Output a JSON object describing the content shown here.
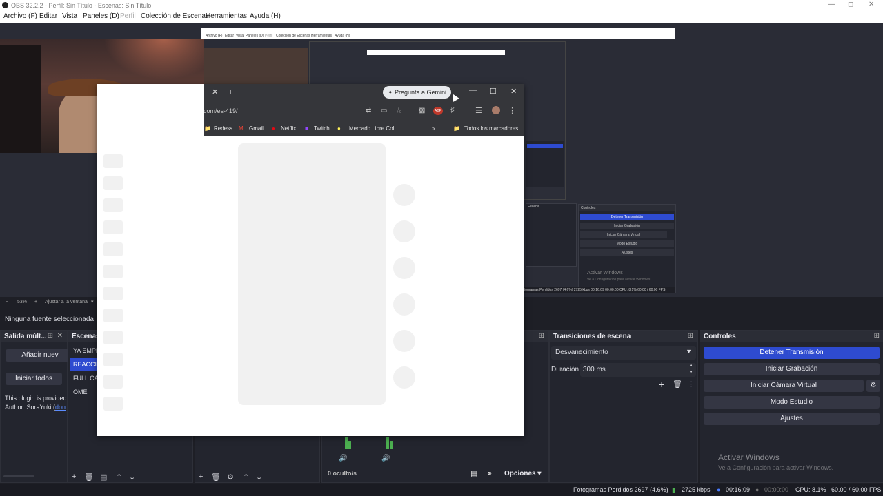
{
  "window": {
    "title": "OBS 32.2.2 - Perfil: Sin Título - Escenas: Sin Título"
  },
  "menu": [
    "Archivo (F)",
    "Editar",
    "Vista",
    "Paneles (D)",
    "Perfil",
    "Colección de Escenas",
    "Herramientas",
    "Ayuda (H)"
  ],
  "nested": {
    "menu": [
      "Archivo (F)",
      "Editar",
      "Vista",
      "Paneles (D)",
      "Perfil",
      "Colección de Escenas",
      "Herramientas",
      "Ayuda (H)"
    ],
    "controls_header": "Controles",
    "scenes_header": "Escena",
    "buttons": [
      "Detener Transmisión",
      "Iniciar Grabación",
      "Iniciar Cámara Virtual",
      "Modo Estudio",
      "Ajustes"
    ],
    "activate_title": "Activar Windows",
    "activate_sub": "Ve a Configuración para activar Windows.",
    "status": "Fotogramas Perdidos 2697 (4.6%)   2725 kbps   00:16:09   00:00:00   CPU: 8.1%   60.00 / 60.00 FPS"
  },
  "zoombar": {
    "zoom": "53%",
    "fit": "Ajustar a la ventana"
  },
  "source_info": "Ninguna fuente seleccionada",
  "docks": {
    "salida": {
      "title": "Salida múlt...",
      "add_button": "Añadir nuev",
      "start_all": "Iniciar todos",
      "plugin_text": "This plugin is provided",
      "author_prefix": "Author: SoraYuki (",
      "author_link": "don"
    },
    "escenas": {
      "title": "Escenas",
      "items": [
        "YA EMPE",
        "REACCIO",
        "FULL CA",
        "OME"
      ],
      "selected_index": 1
    },
    "mixer": {
      "hidden": "0 oculto/s",
      "options": "Opciones"
    },
    "transiciones": {
      "title": "Transiciones de escena",
      "transition": "Desvanecimiento",
      "duration_label": "Duración",
      "duration_value": "300 ms"
    },
    "controles": {
      "title": "Controles",
      "stop_stream": "Detener Transmisión",
      "start_recording": "Iniciar Grabación",
      "start_virtual_cam": "Iniciar Cámara Virtual",
      "studio_mode": "Modo Estudio",
      "settings": "Ajustes"
    }
  },
  "activate_windows": {
    "title": "Activar Windows",
    "subtitle": "Ve a Configuración para activar Windows."
  },
  "status": {
    "dropped": "Fotogramas Perdidos 2697 (4.6%)",
    "bitrate": "2725 kbps",
    "stream_time": "00:16:09",
    "rec_time": "00:00:00",
    "cpu": "CPU: 8.1%",
    "fps": "60.00 / 60.00 FPS"
  },
  "browser": {
    "gemini": "Pregunta a Gemini",
    "url": "com/es-419/",
    "bookmarks": [
      "Redess",
      "Gmail",
      "Netflix",
      "Twitch",
      "Mercado Libre Col..."
    ],
    "all_bookmarks": "Todos los marcadores",
    "skeleton_rows": 12,
    "skeleton_circles": 6
  }
}
